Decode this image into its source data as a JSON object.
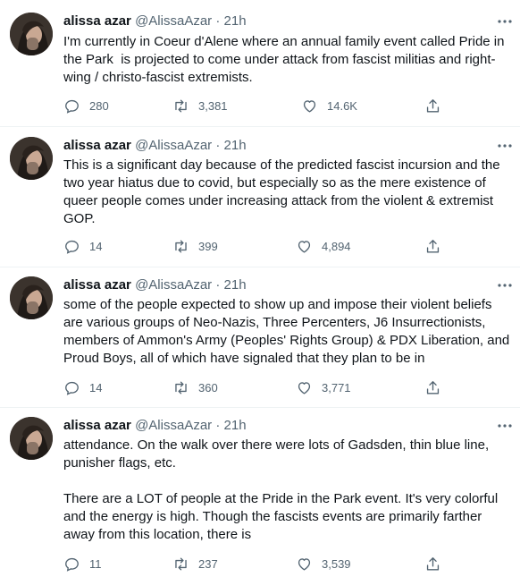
{
  "author": {
    "name": "alissa azar",
    "handle": "@AlissaAzar",
    "separator": "·"
  },
  "colors": {
    "text": "#0f1419",
    "muted": "#536471",
    "divider": "#eff3f4"
  },
  "icons": {
    "reply": "reply-icon",
    "retweet": "retweet-icon",
    "like": "heart-icon",
    "share": "share-icon",
    "more": "more-icon"
  },
  "tweets": [
    {
      "time": "21h",
      "text": "I'm currently in Coeur d'Alene where an annual family event called Pride in\nthe Park  is projected to come under attack from fascist militias and right-\nwing / christo-fascist extremists.",
      "replies": "280",
      "retweets": "3,381",
      "likes": "14.6K"
    },
    {
      "time": "21h",
      "text": "This is a significant day because of the predicted fascist incursion and the\ntwo year hiatus due to covid, but especially so as the mere existence of\nqueer people comes under increasing attack from the violent & extremist\nGOP.",
      "replies": "14",
      "retweets": "399",
      "likes": "4,894"
    },
    {
      "time": "21h",
      "text": "some of the people expected to show up and impose their violent beliefs\nare various groups of Neo-Nazis, Three Percenters, J6 Insurrectionists,\nmembers of Ammon's Army (Peoples' Rights Group) & PDX Liberation, and\nProud Boys, all of which have signaled that they plan to be in",
      "replies": "14",
      "retweets": "360",
      "likes": "3,771"
    },
    {
      "time": "21h",
      "text": "attendance. On the walk over there were lots of Gadsden, thin blue line,\npunisher flags, etc.\n\nThere are a LOT of people at the Pride in the Park event. It's very colorful\nand the energy is high. Though the fascists events are primarily farther\naway from this location, there is",
      "replies": "11",
      "retweets": "237",
      "likes": "3,539"
    }
  ]
}
